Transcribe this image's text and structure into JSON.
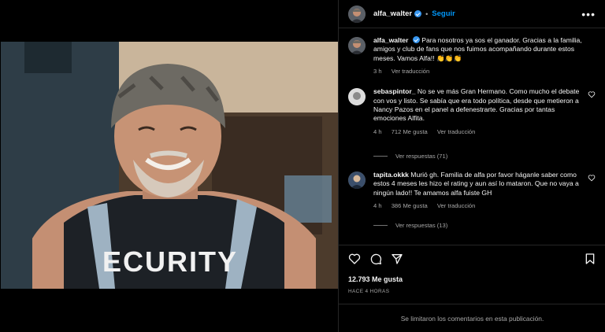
{
  "post": {
    "username": "alfa_walter",
    "follow_label": "Seguir",
    "more_icon": "more-horizontal-icon"
  },
  "comments": [
    {
      "username": "alfa_walter",
      "text": "Para nosotros ya sos el ganador. Gracias a la familia, amigos y club de fans que nos fuimos acompañando durante estos meses. Vamos Alfa!! 👏👏👏",
      "time": "3 h",
      "translate_label": "Ver traducción"
    },
    {
      "username": "sebaspintor_",
      "text": "No se ve más Gran Hermano. Como mucho el debate con vos y listo. Se sabía que era todo política, desde que metieron a Nancy Pazos en el panel a defenestrarte. Gracias por tantas emociones Alfita.",
      "time": "4 h",
      "likes": "712 Me gusta",
      "translate_label": "Ver traducción",
      "replies_label": "Ver respuestas (71)"
    },
    {
      "username": "tapita.okkk",
      "text": "Murió gh. Familia de alfa por favor háganle saber como estos 4 meses les hizo el rating y aun así lo mataron. Que no vaya a ningún lado!! Te amamos alfa fuiste GH",
      "time": "4 h",
      "likes": "386 Me gusta",
      "translate_label": "Ver traducción",
      "replies_label": "Ver respuestas (13)"
    }
  ],
  "actions": {
    "likes_count": "12.793 Me gusta",
    "time_ago": "HACE 4 HORAS",
    "comments_limited": "Se limitaron los comentarios en esta publicación."
  },
  "photo": {
    "shirt_text": "ECURITY"
  },
  "colors": {
    "accent": "#0095f6",
    "verified": "#3897f0",
    "muted": "#a8a8a8",
    "background": "#000000"
  }
}
